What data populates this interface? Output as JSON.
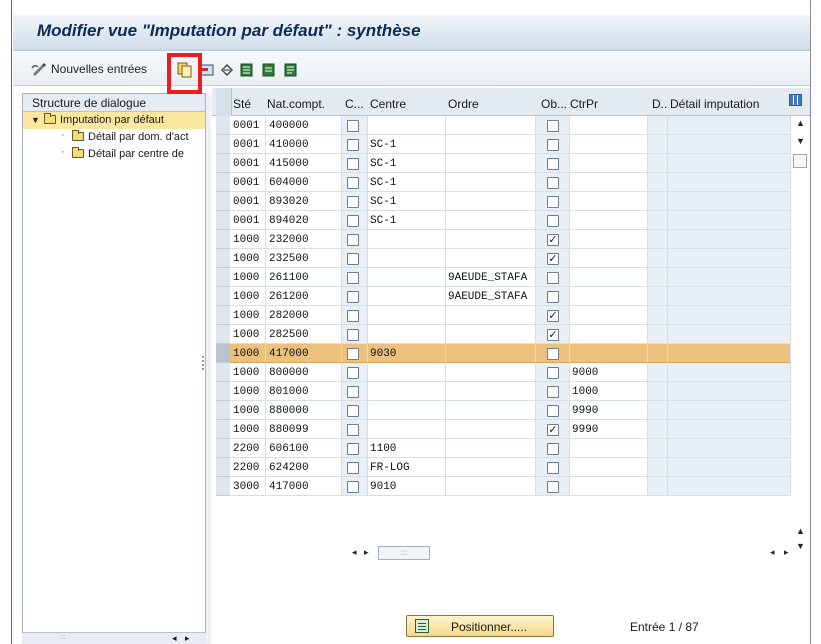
{
  "window": {
    "title": "Modifier vue \"Imputation par défaut\" : synthèse"
  },
  "toolbar": {
    "new_entries_label": "Nouvelles entrées"
  },
  "left_panel": {
    "header": "Structure de dialogue",
    "items": [
      {
        "label": "Imputation par défaut",
        "selected": true
      },
      {
        "label": "Détail par dom. d'act"
      },
      {
        "label": "Détail par centre de"
      }
    ]
  },
  "table": {
    "columns": [
      "Sté",
      "Nat.compt.",
      "C...",
      "Centre",
      "Ordre",
      "Ob...",
      "CtrPr",
      "D..",
      "Détail imputation"
    ],
    "rows": [
      {
        "ste": "0001",
        "nat": "400000",
        "c": false,
        "centre": "",
        "ordre": "",
        "ob": false,
        "ctrpr": ""
      },
      {
        "ste": "0001",
        "nat": "410000",
        "c": false,
        "centre": "SC-1",
        "ordre": "",
        "ob": false,
        "ctrpr": ""
      },
      {
        "ste": "0001",
        "nat": "415000",
        "c": false,
        "centre": "SC-1",
        "ordre": "",
        "ob": false,
        "ctrpr": ""
      },
      {
        "ste": "0001",
        "nat": "604000",
        "c": false,
        "centre": "SC-1",
        "ordre": "",
        "ob": false,
        "ctrpr": ""
      },
      {
        "ste": "0001",
        "nat": "893020",
        "c": false,
        "centre": "SC-1",
        "ordre": "",
        "ob": false,
        "ctrpr": ""
      },
      {
        "ste": "0001",
        "nat": "894020",
        "c": false,
        "centre": "SC-1",
        "ordre": "",
        "ob": false,
        "ctrpr": ""
      },
      {
        "ste": "1000",
        "nat": "232000",
        "c": false,
        "centre": "",
        "ordre": "",
        "ob": true,
        "ctrpr": ""
      },
      {
        "ste": "1000",
        "nat": "232500",
        "c": false,
        "centre": "",
        "ordre": "",
        "ob": true,
        "ctrpr": ""
      },
      {
        "ste": "1000",
        "nat": "261100",
        "c": false,
        "centre": "",
        "ordre": "9AEUDE_STAFA",
        "ob": false,
        "ctrpr": ""
      },
      {
        "ste": "1000",
        "nat": "261200",
        "c": false,
        "centre": "",
        "ordre": "9AEUDE_STAFA",
        "ob": false,
        "ctrpr": ""
      },
      {
        "ste": "1000",
        "nat": "282000",
        "c": false,
        "centre": "",
        "ordre": "",
        "ob": true,
        "ctrpr": ""
      },
      {
        "ste": "1000",
        "nat": "282500",
        "c": false,
        "centre": "",
        "ordre": "",
        "ob": true,
        "ctrpr": ""
      },
      {
        "ste": "1000",
        "nat": "417000",
        "c": false,
        "centre": "9030",
        "ordre": "",
        "ob": false,
        "ctrpr": "",
        "highlight": true
      },
      {
        "ste": "1000",
        "nat": "800000",
        "c": false,
        "centre": "",
        "ordre": "",
        "ob": false,
        "ctrpr": "9000"
      },
      {
        "ste": "1000",
        "nat": "801000",
        "c": false,
        "centre": "",
        "ordre": "",
        "ob": false,
        "ctrpr": "1000"
      },
      {
        "ste": "1000",
        "nat": "880000",
        "c": false,
        "centre": "",
        "ordre": "",
        "ob": false,
        "ctrpr": "9990"
      },
      {
        "ste": "1000",
        "nat": "880099",
        "c": false,
        "centre": "",
        "ordre": "",
        "ob": true,
        "ctrpr": "9990"
      },
      {
        "ste": "2200",
        "nat": "606100",
        "c": false,
        "centre": "1100",
        "ordre": "",
        "ob": false,
        "ctrpr": ""
      },
      {
        "ste": "2200",
        "nat": "624200",
        "c": false,
        "centre": "FR-LOG",
        "ordre": "",
        "ob": false,
        "ctrpr": ""
      },
      {
        "ste": "3000",
        "nat": "417000",
        "c": false,
        "centre": "9010",
        "ordre": "",
        "ob": false,
        "ctrpr": ""
      }
    ]
  },
  "footer": {
    "position_button": "Positionner.....",
    "entry_info": "Entrée 1 / 87"
  },
  "colors": {
    "highlight_row": "#ecc17e",
    "selected_tree_item": "#fbe79f",
    "annotation_box": "#ee1c1c"
  }
}
